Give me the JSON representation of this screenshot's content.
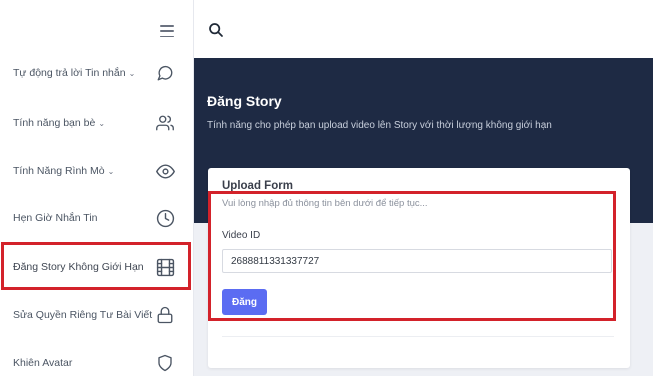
{
  "sidebar": {
    "items": [
      {
        "label": "Tự động trả lời Tin nhắn",
        "has_chevron": true,
        "icon": "message-circle-icon"
      },
      {
        "label": "Tính năng bạn bè",
        "has_chevron": true,
        "icon": "users-icon"
      },
      {
        "label": "Tính Năng Rình Mò",
        "has_chevron": true,
        "icon": "eye-icon"
      },
      {
        "label": "Hẹn Giờ Nhắn Tin",
        "has_chevron": false,
        "icon": "clock-icon"
      },
      {
        "label": "Đăng Story Không Giới Hạn",
        "has_chevron": false,
        "icon": "film-icon",
        "active": true
      },
      {
        "label": "Sửa Quyền Riêng Tư Bài Viết",
        "has_chevron": false,
        "icon": "lock-icon"
      },
      {
        "label": "Khiên Avatar",
        "has_chevron": false,
        "icon": "shield-icon"
      }
    ],
    "chevron": "⌄"
  },
  "header": {
    "title": "Đăng Story",
    "subtitle": "Tính năng cho phép bạn upload video lên Story với thời lượng không giới hạn"
  },
  "form": {
    "title": "Upload Form",
    "description": "Vui lòng nhập đủ thông tin bên dưới để tiếp tục...",
    "video_id_label": "Video ID",
    "video_id_value": "2688811331337727",
    "submit_label": "Đăng"
  },
  "colors": {
    "header_bg": "#1e2a44",
    "accent_button": "#5b6cf2",
    "highlight_border": "#d3222a"
  }
}
